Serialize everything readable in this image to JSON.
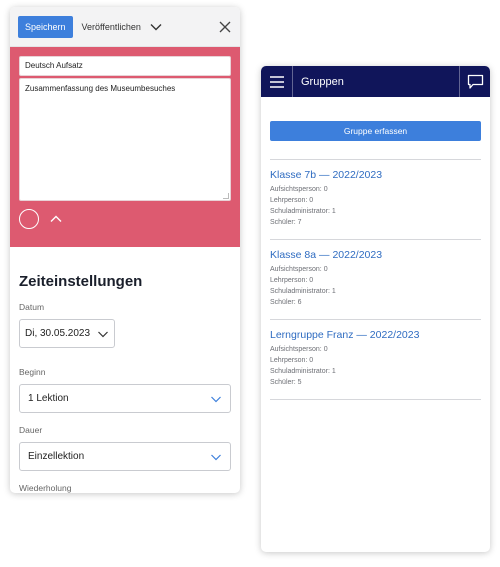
{
  "editor": {
    "save_label": "Speichern",
    "publish_label": "Veröffentlichen",
    "title_value": "Deutsch Aufsatz",
    "summary_value": "Zusammenfassung des Museumbesuches"
  },
  "settings": {
    "heading": "Zeiteinstellungen",
    "date_label": "Datum",
    "date_value": "Di, 30.05.2023",
    "start_label": "Beginn",
    "start_value": "1 Lektion",
    "duration_label": "Dauer",
    "duration_value": "Einzellektion",
    "repeat_label": "Wiederholung"
  },
  "groups_page": {
    "title": "Gruppen",
    "create_button": "Gruppe erfassen",
    "groups": [
      {
        "name": "Klasse 7b — 2022/2023",
        "supervisor": "Aufsichtsperson: 0",
        "teacher": "Lehrperson: 0",
        "admin": "Schuladministrator: 1",
        "students": "Schüler: 7"
      },
      {
        "name": "Klasse 8a — 2022/2023",
        "supervisor": "Aufsichtsperson: 0",
        "teacher": "Lehrperson: 0",
        "admin": "Schuladministrator: 1",
        "students": "Schüler: 6"
      },
      {
        "name": "Lerngruppe Franz — 2022/2023",
        "supervisor": "Aufsichtsperson: 0",
        "teacher": "Lehrperson: 0",
        "admin": "Schuladministrator: 1",
        "students": "Schüler: 5"
      }
    ]
  },
  "colors": {
    "accent_blue": "#3d7fdc",
    "nav_navy": "#10155a",
    "card_red": "#dd5a70",
    "link_blue": "#2f6cc1"
  },
  "icons": {
    "publish_dropdown": "chevron-down-icon",
    "close": "close-icon",
    "circle": "circle-icon",
    "collapse": "chevron-up-icon",
    "menu": "hamburger-menu-icon",
    "chat": "chat-bubble-icon"
  }
}
